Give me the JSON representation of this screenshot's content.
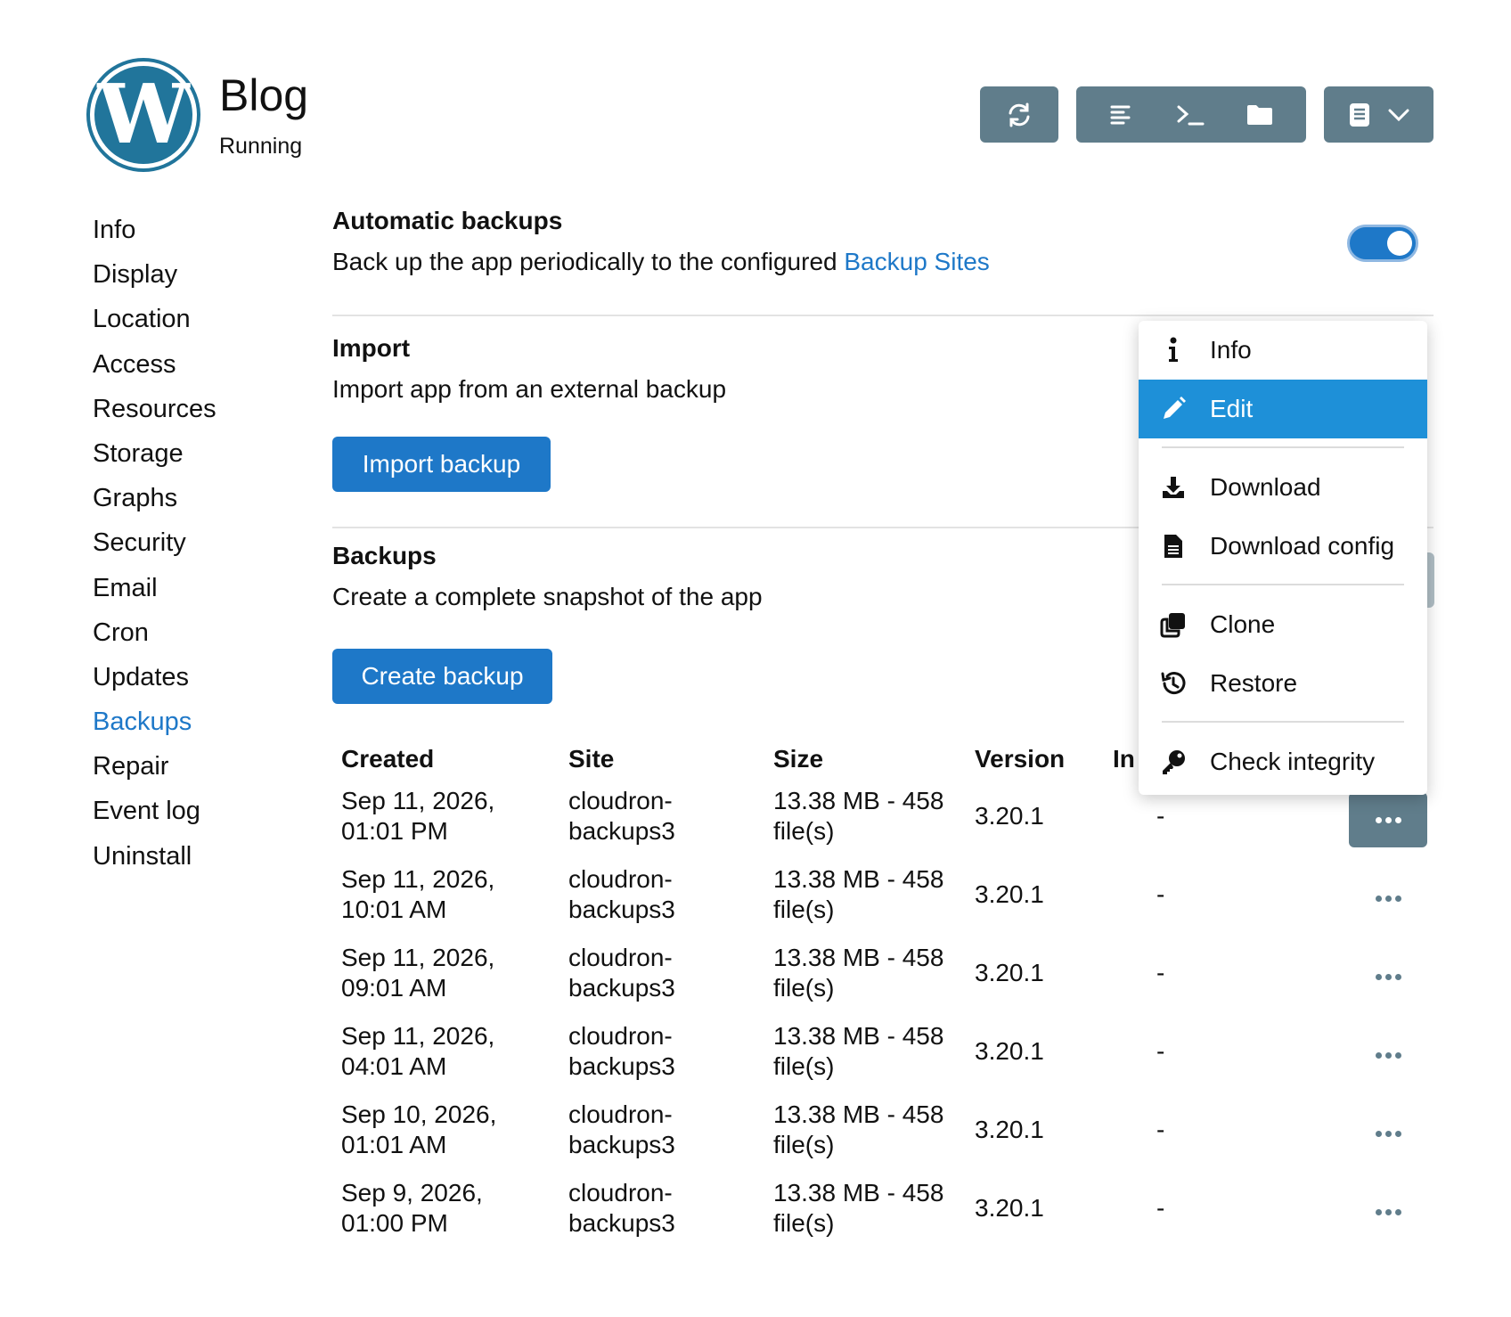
{
  "app": {
    "title": "Blog",
    "status": "Running",
    "logo": "wordpress-logo"
  },
  "toolbar": {
    "restart_icon": "refresh-icon",
    "group_icons": [
      "logs-icon",
      "terminal-icon",
      "folder-icon"
    ],
    "more_icons": [
      "docs-icon",
      "chevron-down-icon"
    ]
  },
  "sidebar": {
    "items": [
      {
        "label": "Info"
      },
      {
        "label": "Display"
      },
      {
        "label": "Location"
      },
      {
        "label": "Access"
      },
      {
        "label": "Resources"
      },
      {
        "label": "Storage"
      },
      {
        "label": "Graphs"
      },
      {
        "label": "Security"
      },
      {
        "label": "Email"
      },
      {
        "label": "Cron"
      },
      {
        "label": "Updates"
      },
      {
        "label": "Backups"
      },
      {
        "label": "Repair"
      },
      {
        "label": "Event log"
      },
      {
        "label": "Uninstall"
      }
    ],
    "active": "Backups"
  },
  "auto_backups": {
    "title": "Automatic backups",
    "desc_prefix": "Back up the app periodically to the configured ",
    "desc_link": "Backup Sites",
    "enabled": true
  },
  "import": {
    "title": "Import",
    "desc": "Import app from an external backup",
    "button": "Import backup"
  },
  "backups": {
    "title": "Backups",
    "desc": "Create a complete snapshot of the app",
    "button": "Create backup",
    "columns": [
      "Created",
      "Site",
      "Size",
      "Version",
      "In"
    ],
    "rows": [
      {
        "date": "Sep 11, 2026,",
        "time": "01:01 PM",
        "site1": "cloudron-",
        "site2": "backups3",
        "size1": "13.38 MB - 458",
        "size2": "file(s)",
        "version": "3.20.1",
        "integrity": "-"
      },
      {
        "date": "Sep 11, 2026,",
        "time": "10:01 AM",
        "site1": "cloudron-",
        "site2": "backups3",
        "size1": "13.38 MB - 458",
        "size2": "file(s)",
        "version": "3.20.1",
        "integrity": "-"
      },
      {
        "date": "Sep 11, 2026,",
        "time": "09:01 AM",
        "site1": "cloudron-",
        "site2": "backups3",
        "size1": "13.38 MB - 458",
        "size2": "file(s)",
        "version": "3.20.1",
        "integrity": "-"
      },
      {
        "date": "Sep 11, 2026,",
        "time": "04:01 AM",
        "site1": "cloudron-",
        "site2": "backups3",
        "size1": "13.38 MB - 458",
        "size2": "file(s)",
        "version": "3.20.1",
        "integrity": "-"
      },
      {
        "date": "Sep 10, 2026,",
        "time": "01:01 AM",
        "site1": "cloudron-",
        "site2": "backups3",
        "size1": "13.38 MB - 458",
        "size2": "file(s)",
        "version": "3.20.1",
        "integrity": "-"
      },
      {
        "date": "Sep 9, 2026,",
        "time": "01:00 PM",
        "site1": "cloudron-",
        "site2": "backups3",
        "size1": "13.38 MB - 458",
        "size2": "file(s)",
        "version": "3.20.1",
        "integrity": "-"
      }
    ]
  },
  "menu": {
    "items": [
      {
        "label": "Info",
        "icon": "info-icon"
      },
      {
        "label": "Edit",
        "icon": "pencil-icon",
        "highlighted": true
      },
      {
        "label": "Download",
        "icon": "download-icon"
      },
      {
        "label": "Download config",
        "icon": "file-icon"
      },
      {
        "label": "Clone",
        "icon": "clone-icon"
      },
      {
        "label": "Restore",
        "icon": "history-icon"
      },
      {
        "label": "Check integrity",
        "icon": "key-icon"
      }
    ]
  },
  "colors": {
    "accent": "#1e78c8",
    "toolbar": "#607d8b",
    "highlight": "#1e90d8"
  }
}
